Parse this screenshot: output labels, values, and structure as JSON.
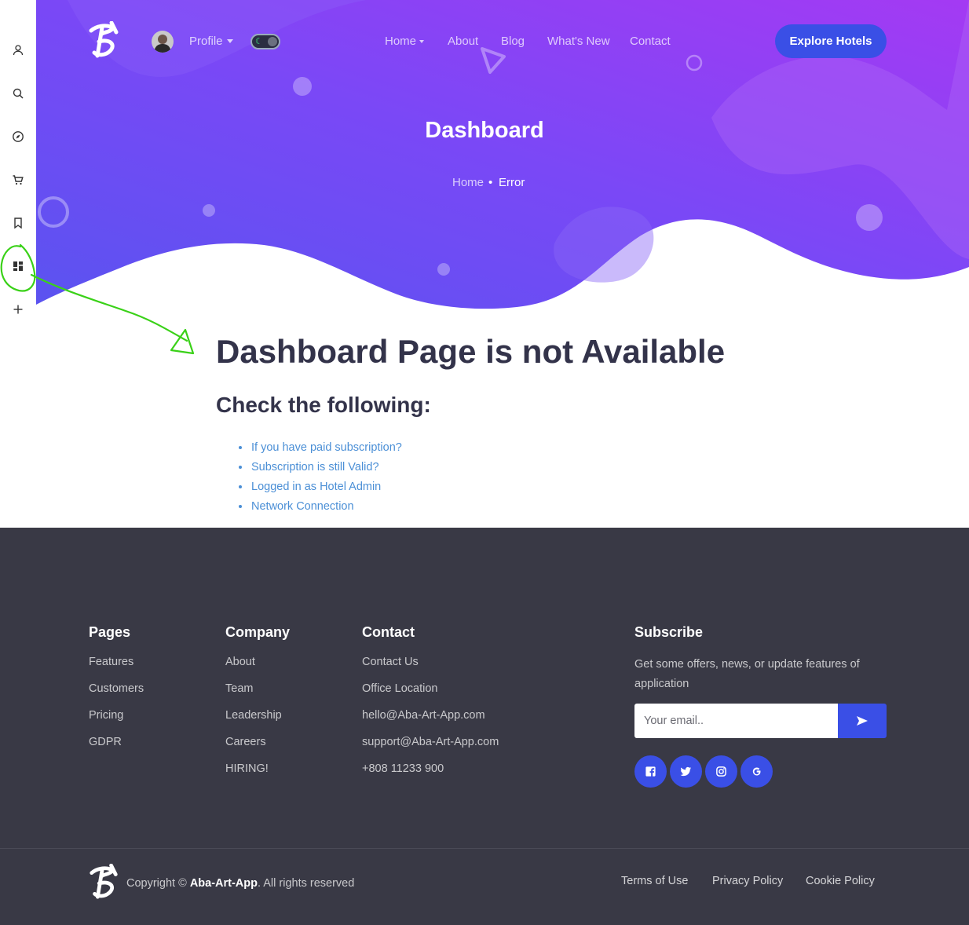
{
  "sidebar": {
    "items": [
      {
        "icon": "user-icon"
      },
      {
        "icon": "search-icon"
      },
      {
        "icon": "compass-icon"
      },
      {
        "icon": "cart-icon"
      },
      {
        "icon": "bookmark-icon"
      },
      {
        "icon": "dashboard-icon"
      },
      {
        "icon": "plus-icon"
      }
    ]
  },
  "header": {
    "profile_label": "Profile",
    "nav": {
      "home": "Home",
      "about": "About",
      "blog": "Blog",
      "whats_new": "What's New",
      "contact": "Contact"
    },
    "cta": "Explore Hotels"
  },
  "hero": {
    "title": "Dashboard",
    "breadcrumb": {
      "home": "Home",
      "separator": "•",
      "current": "Error"
    }
  },
  "main": {
    "title": "Dashboard Page is not Available",
    "subtitle": "Check the following:",
    "checks": [
      "If you have paid subscription?",
      "Subscription is still Valid?",
      "Logged in as Hotel Admin",
      "Network Connection"
    ]
  },
  "footer": {
    "pages": {
      "heading": "Pages",
      "links": [
        "Features",
        "Customers",
        "Pricing",
        "GDPR"
      ]
    },
    "company": {
      "heading": "Company",
      "links": [
        "About",
        "Team",
        "Leadership",
        "Careers",
        "HIRING!"
      ]
    },
    "contact": {
      "heading": "Contact",
      "links": [
        "Contact Us",
        "Office Location",
        "hello@Aba-Art-App.com",
        "support@Aba-Art-App.com",
        "+808 11233 900"
      ]
    },
    "subscribe": {
      "heading": "Subscribe",
      "text": "Get some offers, news, or update features of application",
      "placeholder": "Your email.."
    },
    "social": [
      "facebook-icon",
      "twitter-icon",
      "instagram-icon",
      "google-icon"
    ],
    "copyright": {
      "prefix": "Copyright ©",
      "brand": "Aba-Art-App",
      "suffix": ". All rights reserved"
    },
    "legal": {
      "terms": "Terms of Use",
      "privacy": "Privacy Policy",
      "cookie": "Cookie Policy"
    }
  },
  "colors": {
    "accent": "#3a4fe6",
    "hero_gradient_start": "#6b5cf6",
    "hero_gradient_end": "#9b3bf5",
    "footer_bg": "#393945",
    "link": "#4b8fd6",
    "annotation": "#3ad118"
  }
}
